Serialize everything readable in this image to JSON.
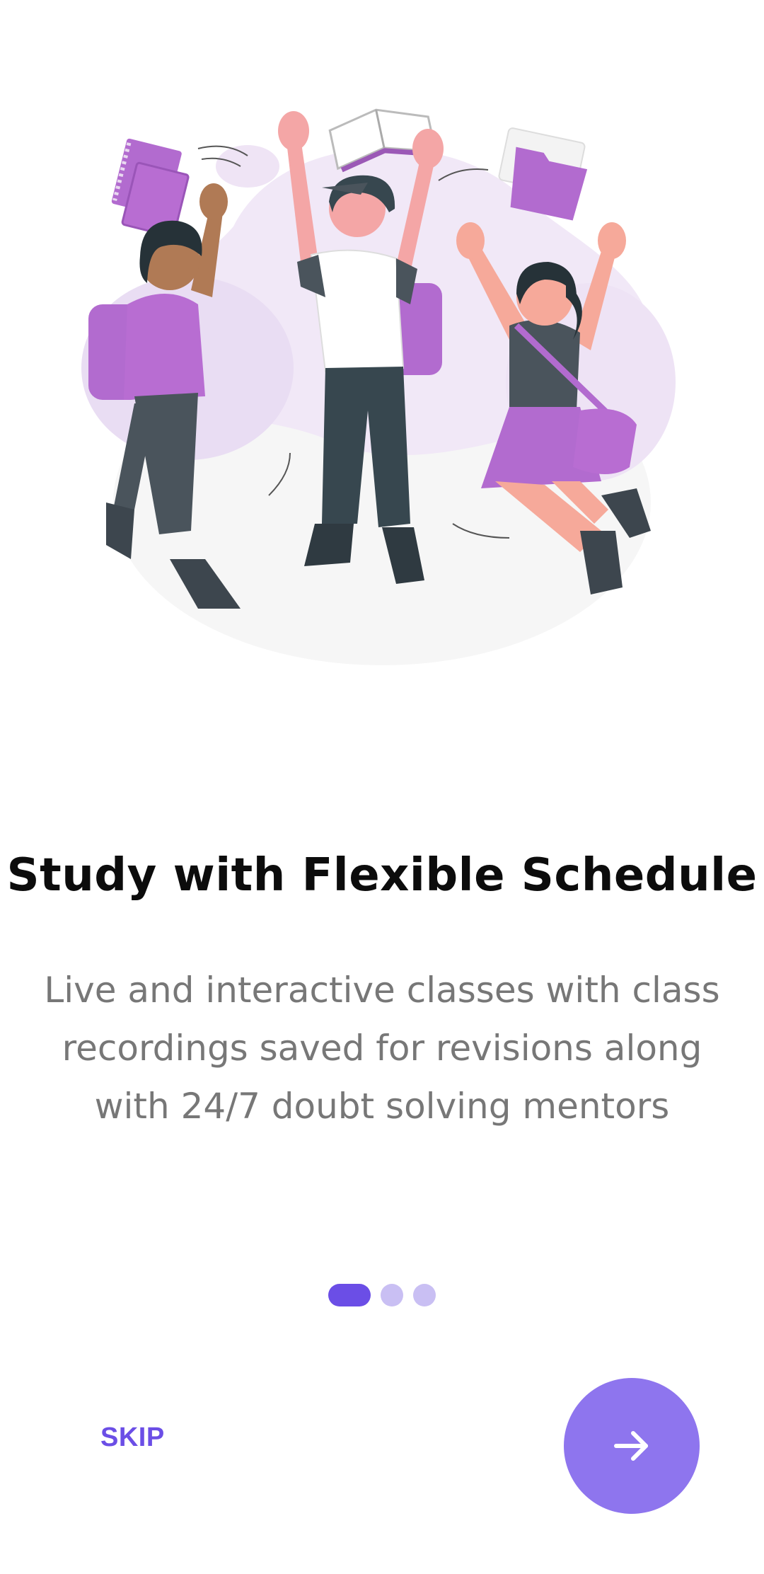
{
  "onboarding": {
    "title": "Study with Flexible Schedule",
    "description_lines": [
      "Live and interactive classes with class",
      "recordings saved for revisions along",
      "with 24/7 doubt solving mentors"
    ],
    "page_indicator": {
      "current": 1,
      "total": 3
    },
    "skip_label": "SKIP",
    "next_icon": "arrow-right-icon"
  },
  "colors": {
    "accent": "#6b4ee6",
    "next_button": "#8e75ee",
    "dot_inactive": "#c9bff3",
    "title": "#0c0c0c",
    "description": "#777777"
  }
}
